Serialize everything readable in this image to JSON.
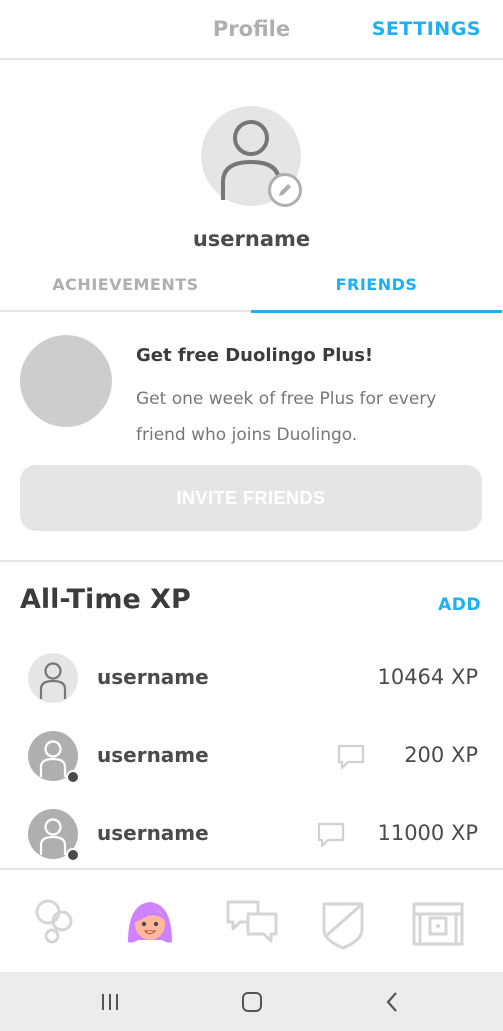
{
  "header": {
    "title": "Profile",
    "settings_label": "SETTINGS"
  },
  "profile": {
    "username": "username",
    "avatar_icon": "person-icon",
    "edit_icon": "pencil-icon"
  },
  "tabs": [
    {
      "label": "ACHIEVEMENTS",
      "active": false
    },
    {
      "label": "FRIENDS",
      "active": true
    }
  ],
  "promo": {
    "title": "Get free Duolingo Plus!",
    "text": "Get one week of free Plus for every friend who joins Duolingo.",
    "button_label": "INVITE FRIENDS"
  },
  "leaderboard": {
    "title": "All-Time XP",
    "add_label": "ADD",
    "friends": [
      {
        "name": "username",
        "xp": "10464 XP",
        "online": false,
        "has_chat": false
      },
      {
        "name": "username",
        "xp": "200 XP",
        "online": true,
        "has_chat": true
      },
      {
        "name": "username",
        "xp": "11000 XP",
        "online": true,
        "has_chat": true
      }
    ]
  },
  "bottom_nav": {
    "items": [
      "learn-icon",
      "profile-avatar-icon",
      "discussion-icon",
      "league-shield-icon",
      "shop-chest-icon"
    ],
    "active": "profile-avatar-icon"
  },
  "system_nav": {
    "items": [
      "recents-icon",
      "home-icon",
      "back-icon"
    ]
  },
  "colors": {
    "accent": "#1cb0f6",
    "text": "#4b4b4b",
    "muted": "#afafaf",
    "divider": "#e5e5e5",
    "avatar_purple": "#ce82ff",
    "avatar_skin": "#ffb99a"
  }
}
